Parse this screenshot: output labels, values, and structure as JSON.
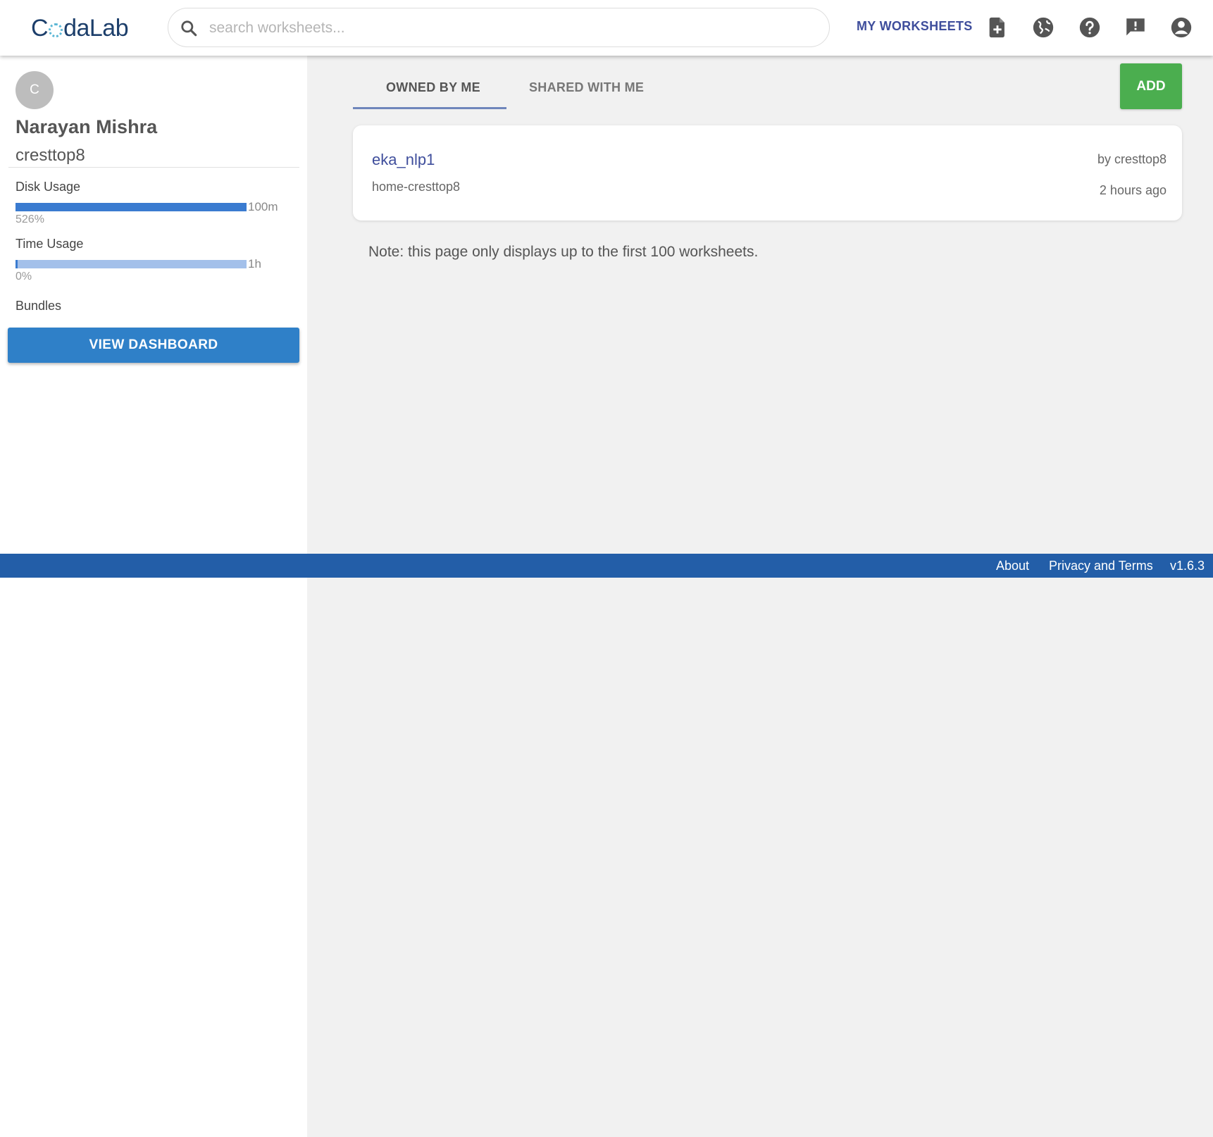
{
  "app": {
    "logo_text_start": "C",
    "logo_text_end": "daLab"
  },
  "search": {
    "placeholder": "search worksheets...",
    "value": ""
  },
  "header": {
    "my_worksheets_label": "MY WORKSHEETS",
    "icons": [
      "new-worksheet-icon",
      "gallery-globe-icon",
      "help-icon",
      "feedback-icon",
      "account-icon"
    ]
  },
  "user": {
    "avatar_initial": "C",
    "full_name": "Narayan Mishra",
    "username": "cresttop8"
  },
  "usage": {
    "disk": {
      "label": "Disk Usage",
      "limit": "100m",
      "percent_text": "526%",
      "fill_fraction": 1.0
    },
    "time": {
      "label": "Time Usage",
      "limit": "1h",
      "percent_text": "0%",
      "fill_fraction": 0.0
    },
    "bundles_label": "Bundles"
  },
  "dashboard_button": "VIEW DASHBOARD",
  "tabs": [
    {
      "label": "OWNED BY ME",
      "active": true
    },
    {
      "label": "SHARED WITH ME",
      "active": false
    }
  ],
  "add_button": "ADD",
  "worksheets": [
    {
      "title": "eka_nlp1",
      "name": "home-cresttop8",
      "owner": "by cresttop8",
      "modified": "2 hours ago"
    }
  ],
  "note": "Note: this page only displays up to the first 100 worksheets.",
  "footer": {
    "about": "About",
    "privacy": "Privacy and Terms",
    "version": "v1.6.3"
  },
  "colors": {
    "primary": "#235ea8",
    "add_green": "#4bae4f",
    "bar_fill": "#3a7bd0",
    "bar_track": "#a3c0ea",
    "link": "#3f4e9c"
  }
}
